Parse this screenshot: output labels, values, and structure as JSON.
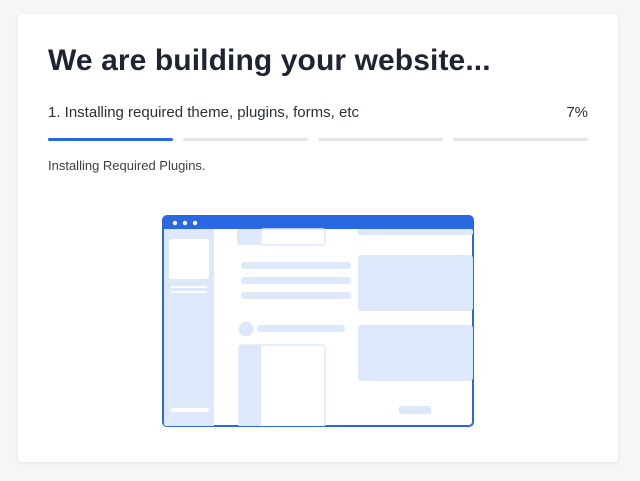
{
  "page": {
    "title": "We are building your website...",
    "step_label": "1. Installing required theme, plugins, forms, etc",
    "percent_label": "7%",
    "progress_percent": 7,
    "status_text": "Installing Required Plugins.",
    "steps_total": 4,
    "steps_completed": 1
  },
  "colors": {
    "accent": "#2a67e3",
    "segment_inactive": "#e5e6e9",
    "title": "#1e2433",
    "illustration_fill": "#dde9fb"
  },
  "illustration": {
    "icon": "browser-window-illustration"
  }
}
